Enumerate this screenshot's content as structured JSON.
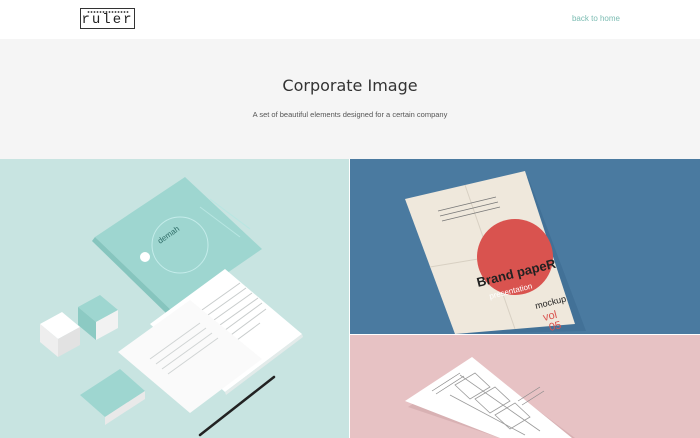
{
  "header": {
    "logo_text": "ruler",
    "back_link": "back to home"
  },
  "hero": {
    "title": "Corporate Image",
    "subtitle": "A set of beautiful elements designed for a certain company"
  },
  "gallery": {
    "tiles": [
      {
        "name": "stationery-mockup",
        "background": "#c8e4e1",
        "brand_text": "demah"
      },
      {
        "name": "brand-paper-mockup",
        "background": "#4a7aa0",
        "poster_title": "Brand papeR",
        "poster_sub": "presentation",
        "poster_mockup": "mockup",
        "poster_vol": "vol",
        "poster_num": "05"
      },
      {
        "name": "brochure-mockup",
        "background": "#e7c2c4"
      }
    ]
  },
  "colors": {
    "accent": "#7bbcb2",
    "hero_background": "#f5f5f5",
    "poster_circle": "#d9534f"
  }
}
